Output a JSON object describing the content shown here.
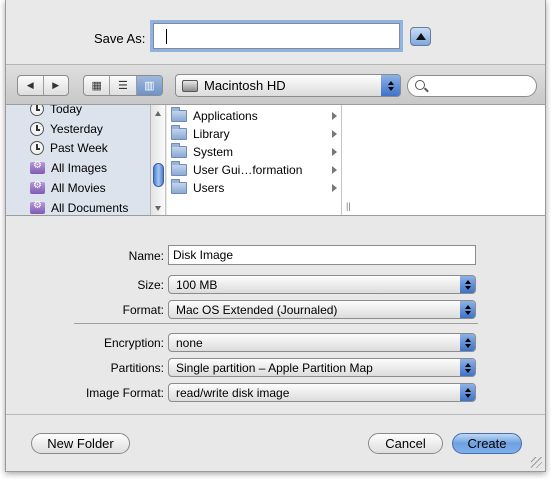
{
  "save_as": {
    "label": "Save As:",
    "value": ""
  },
  "toolbar": {
    "back_glyph": "◀",
    "forward_glyph": "▶",
    "view_icons_glyph": "▦",
    "view_list_glyph": "☰",
    "view_columns_glyph": "▥",
    "location": "Macintosh HD"
  },
  "sidebar": {
    "items": [
      {
        "label": "Today",
        "icon": "clock-icon"
      },
      {
        "label": "Yesterday",
        "icon": "clock-icon"
      },
      {
        "label": "Past Week",
        "icon": "clock-icon"
      },
      {
        "label": "All Images",
        "icon": "smart-folder-icon"
      },
      {
        "label": "All Movies",
        "icon": "smart-folder-icon"
      },
      {
        "label": "All Documents",
        "icon": "smart-folder-icon"
      }
    ]
  },
  "browser": {
    "items": [
      {
        "label": "Applications"
      },
      {
        "label": "Library"
      },
      {
        "label": "System"
      },
      {
        "label": "User Gui…formation"
      },
      {
        "label": "Users"
      }
    ]
  },
  "options": {
    "name_label": "Name:",
    "name_value": "Disk Image",
    "size_label": "Size:",
    "size_value": "100 MB",
    "format_label": "Format:",
    "format_value": "Mac OS Extended (Journaled)",
    "encryption_label": "Encryption:",
    "encryption_value": "none",
    "partitions_label": "Partitions:",
    "partitions_value": "Single partition – Apple Partition Map",
    "image_format_label": "Image Format:",
    "image_format_value": "read/write disk image"
  },
  "buttons": {
    "new_folder": "New Folder",
    "cancel": "Cancel",
    "create": "Create"
  },
  "colors": {
    "accent": "#6ea0e0",
    "sidebar_bg": "#dce3ec",
    "focus_ring": "#8fb3e5"
  }
}
